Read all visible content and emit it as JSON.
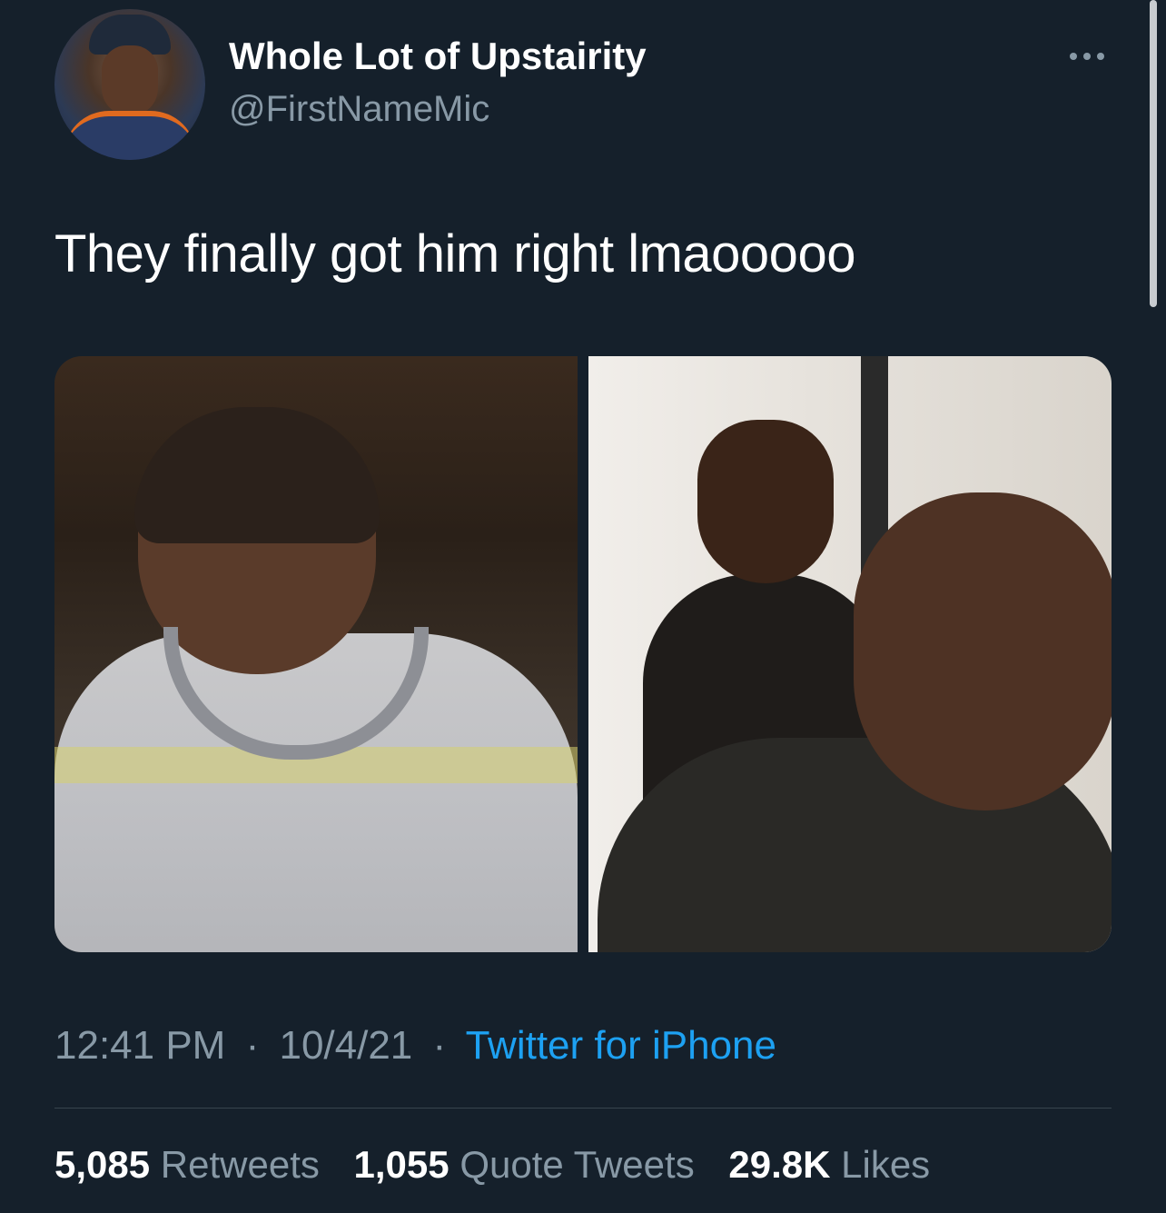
{
  "tweet": {
    "author": {
      "display_name": "Whole Lot of Upstairity",
      "handle": "@FirstNameMic"
    },
    "text": "They finally got him right lmaooooo",
    "timestamp": {
      "time": "12:41 PM",
      "date": "10/4/21",
      "source": "Twitter for iPhone",
      "separator": "·"
    },
    "stats": {
      "retweets": {
        "count": "5,085",
        "label": "Retweets"
      },
      "quote_tweets": {
        "count": "1,055",
        "label": "Quote Tweets"
      },
      "likes": {
        "count": "29.8K",
        "label": "Likes"
      }
    }
  },
  "icons": {
    "more": "more-horizontal-icon"
  },
  "colors": {
    "background": "#15202b",
    "primary_text": "#ffffff",
    "secondary_text": "#8899a6",
    "link": "#1da1f2",
    "divider": "#38444d"
  }
}
